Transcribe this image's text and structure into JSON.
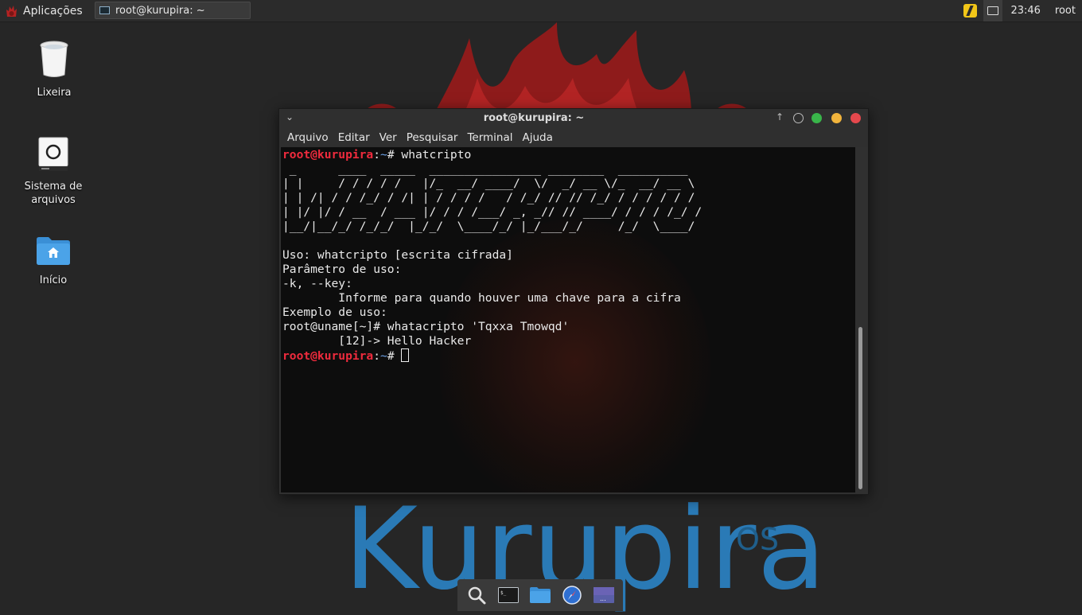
{
  "top_panel": {
    "apps_label": "Aplicações",
    "task_title": "root@kurupira: ~",
    "clock": "23:46",
    "user": "root"
  },
  "desktop": {
    "icons": [
      {
        "label": "Lixeira",
        "icon": "trash-icon"
      },
      {
        "label": "Sistema de arquivos",
        "icon": "drive-icon"
      },
      {
        "label": "Início",
        "icon": "home-folder-icon"
      }
    ],
    "wallpaper_text": "Kurupira",
    "wallpaper_os": "OS"
  },
  "window": {
    "title": "root@kurupira: ~",
    "menu": [
      "Arquivo",
      "Editar",
      "Ver",
      "Pesquisar",
      "Terminal",
      "Ajuda"
    ]
  },
  "terminal": {
    "prompt_user": "root@kurupira",
    "prompt_colon": ":",
    "prompt_path": "~",
    "prompt_symbol": "# ",
    "first_command": "whatcripto",
    "banner": [
      " _      ____  _____  ________________ ________  __________",
      "| |     / / / / /   |/_  __/ ____/  \\/  _/ __ \\/_  __/ __ \\",
      "| | /| / / /_/ / /| | / / / /   / /_/ // // /_/ / / / / / /",
      "| |/ |/ / __  / ___ |/ / / /___/ _, _// // ____/ / / / /_/ /",
      "|__/|__/_/ /_/_/  |_/_/  \\____/_/ |_/___/_/     /_/  \\____/"
    ],
    "output": [
      "",
      "Uso: whatcripto [escrita cifrada]",
      "Parâmetro de uso:",
      "-k, --key:",
      "        Informe para quando houver uma chave para a cifra",
      "Exemplo de uso:",
      "root@uname[~]# whatacripto 'Tqxxa Tmowqd'",
      "        [12]-> Hello Hacker"
    ]
  },
  "dock": {
    "items": [
      "search-icon",
      "terminal-icon",
      "files-icon",
      "browser-icon",
      "workspace-icon"
    ]
  },
  "colors": {
    "prompt_user": "#ef2b3d",
    "prompt_path": "#6fa3e8",
    "brand": "#2a7ab6",
    "close": "#e5484d",
    "maximize": "#f1b43c",
    "minimize": "#39b54a"
  }
}
